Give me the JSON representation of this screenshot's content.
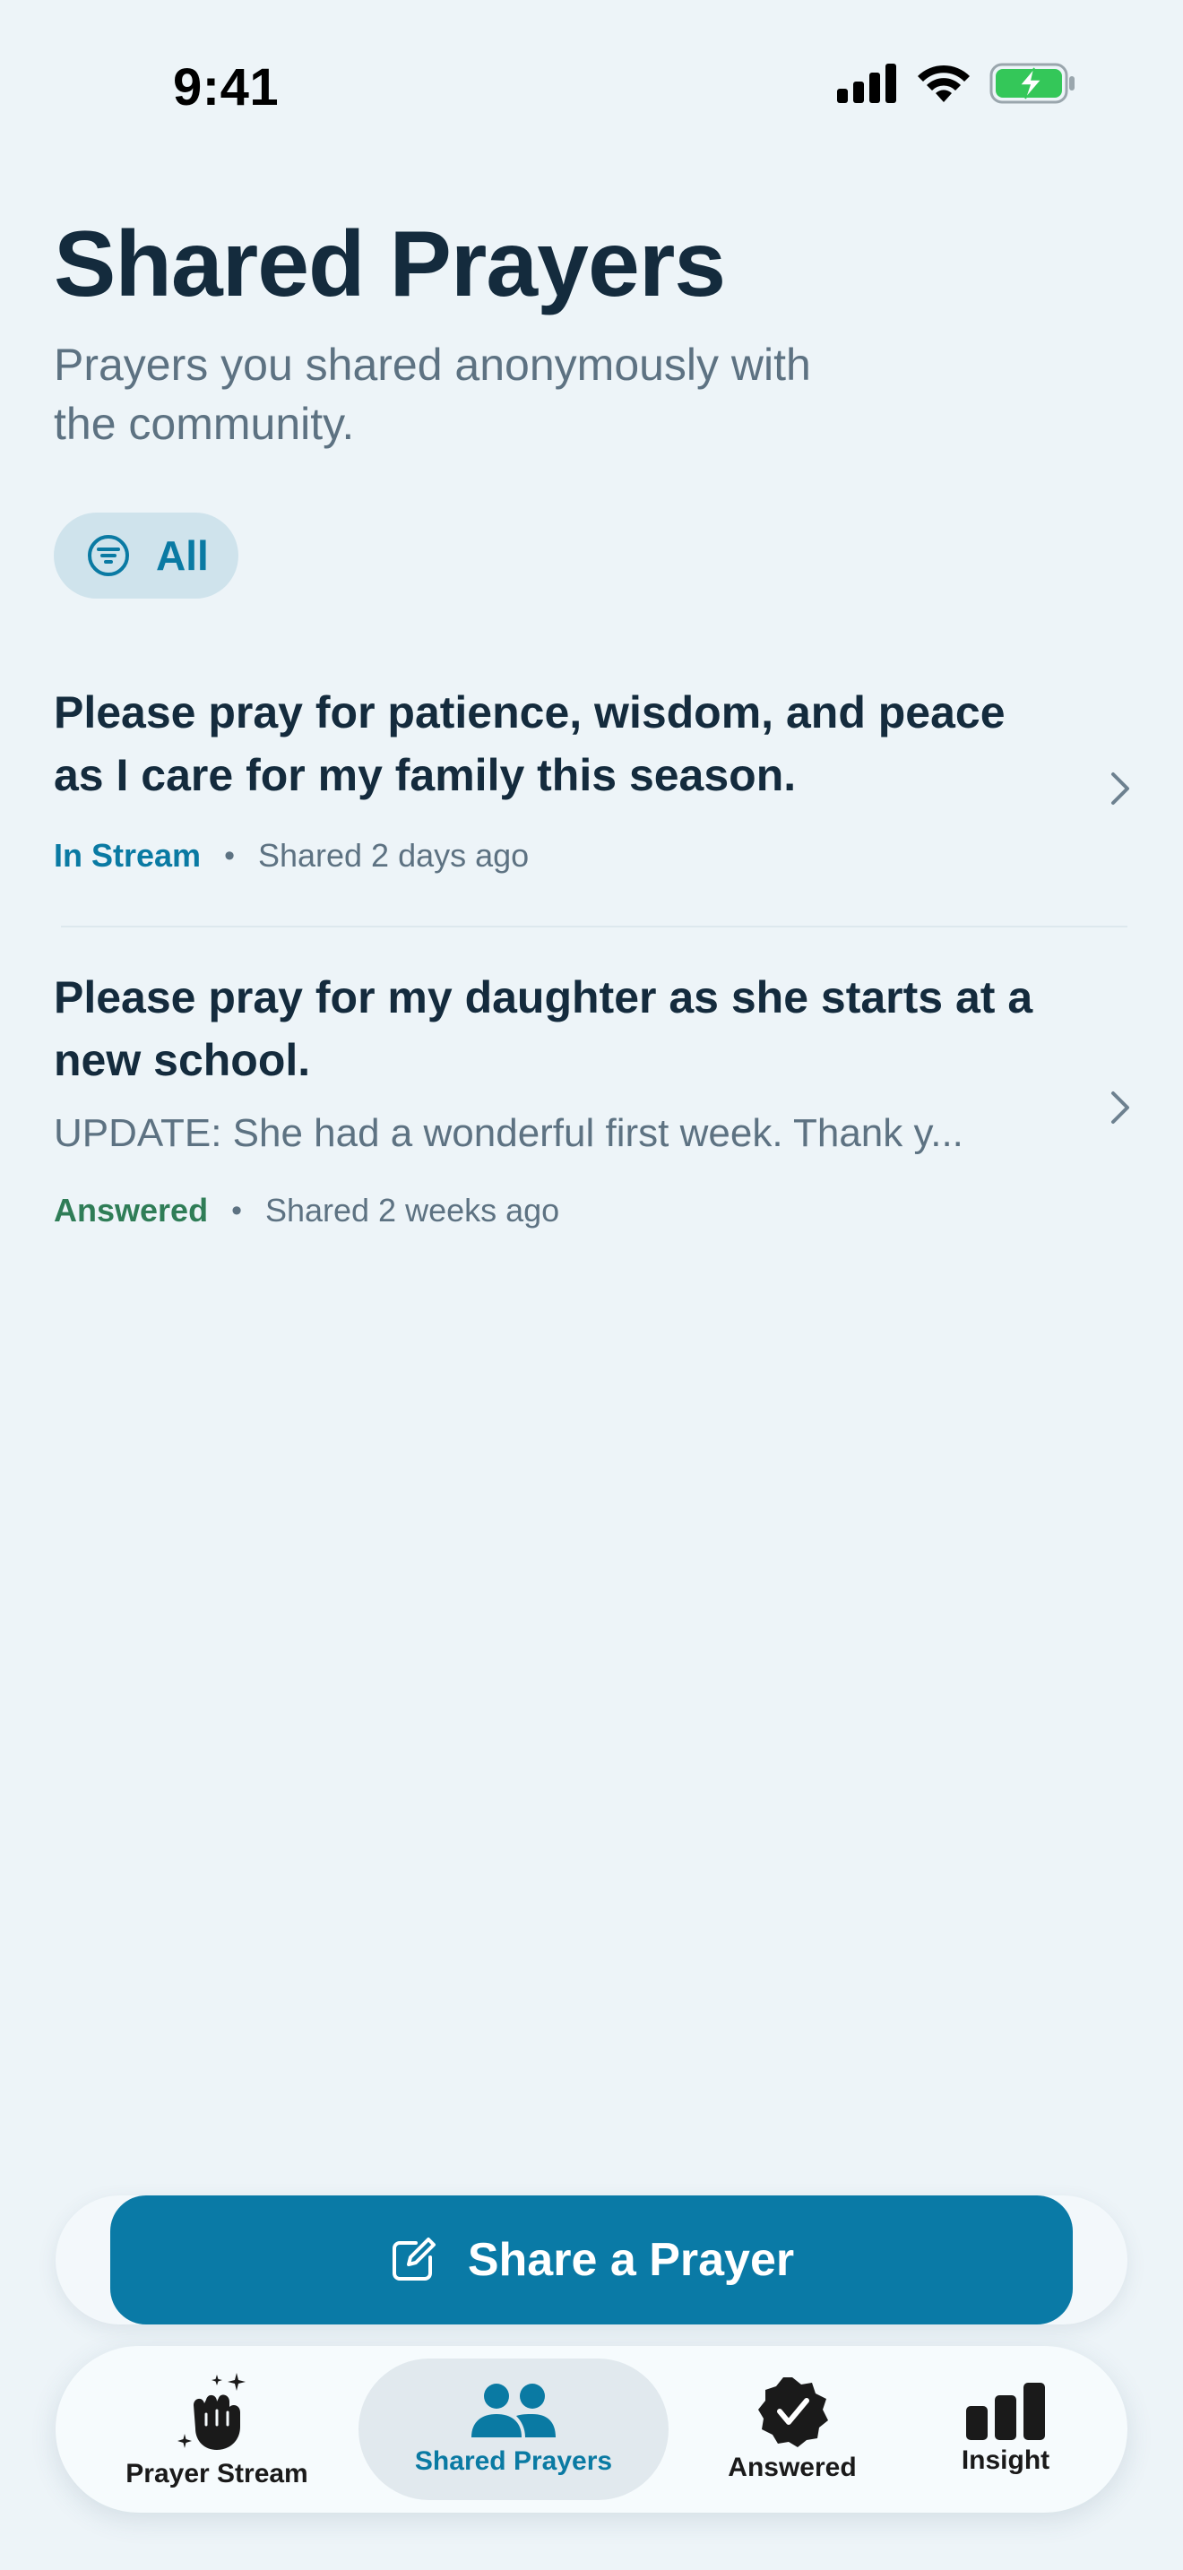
{
  "status_bar": {
    "time": "9:41"
  },
  "header": {
    "title": "Shared Prayers",
    "subtitle": "Prayers you shared anonymously with the community."
  },
  "filter": {
    "label": "All"
  },
  "prayers": [
    {
      "text": "Please pray for patience, wisdom, and peace as I care for my family this season.",
      "status": "In Stream",
      "status_color": "#0a7aa3",
      "time": "Shared 2 days ago"
    },
    {
      "text": "Please pray for my daughter as she starts at a new school.",
      "update": "UPDATE: She had a wonderful first week. Thank y...",
      "status": "Answered",
      "status_color": "#2f7d57",
      "time": "Shared 2 weeks ago"
    }
  ],
  "share_button": {
    "label": "Share a Prayer",
    "color": "#0a7aa6"
  },
  "tabs": [
    {
      "label": "Prayer Stream",
      "icon": "praying-hands-icon"
    },
    {
      "label": "Shared Prayers",
      "icon": "people-icon",
      "active": true
    },
    {
      "label": "Answered",
      "icon": "check-badge-icon"
    },
    {
      "label": "Insight",
      "icon": "bar-chart-icon"
    }
  ],
  "colors": {
    "accent": "#0a7aa3",
    "background": "#edf4f8",
    "text": "#142b3d",
    "muted": "#5d7282"
  }
}
